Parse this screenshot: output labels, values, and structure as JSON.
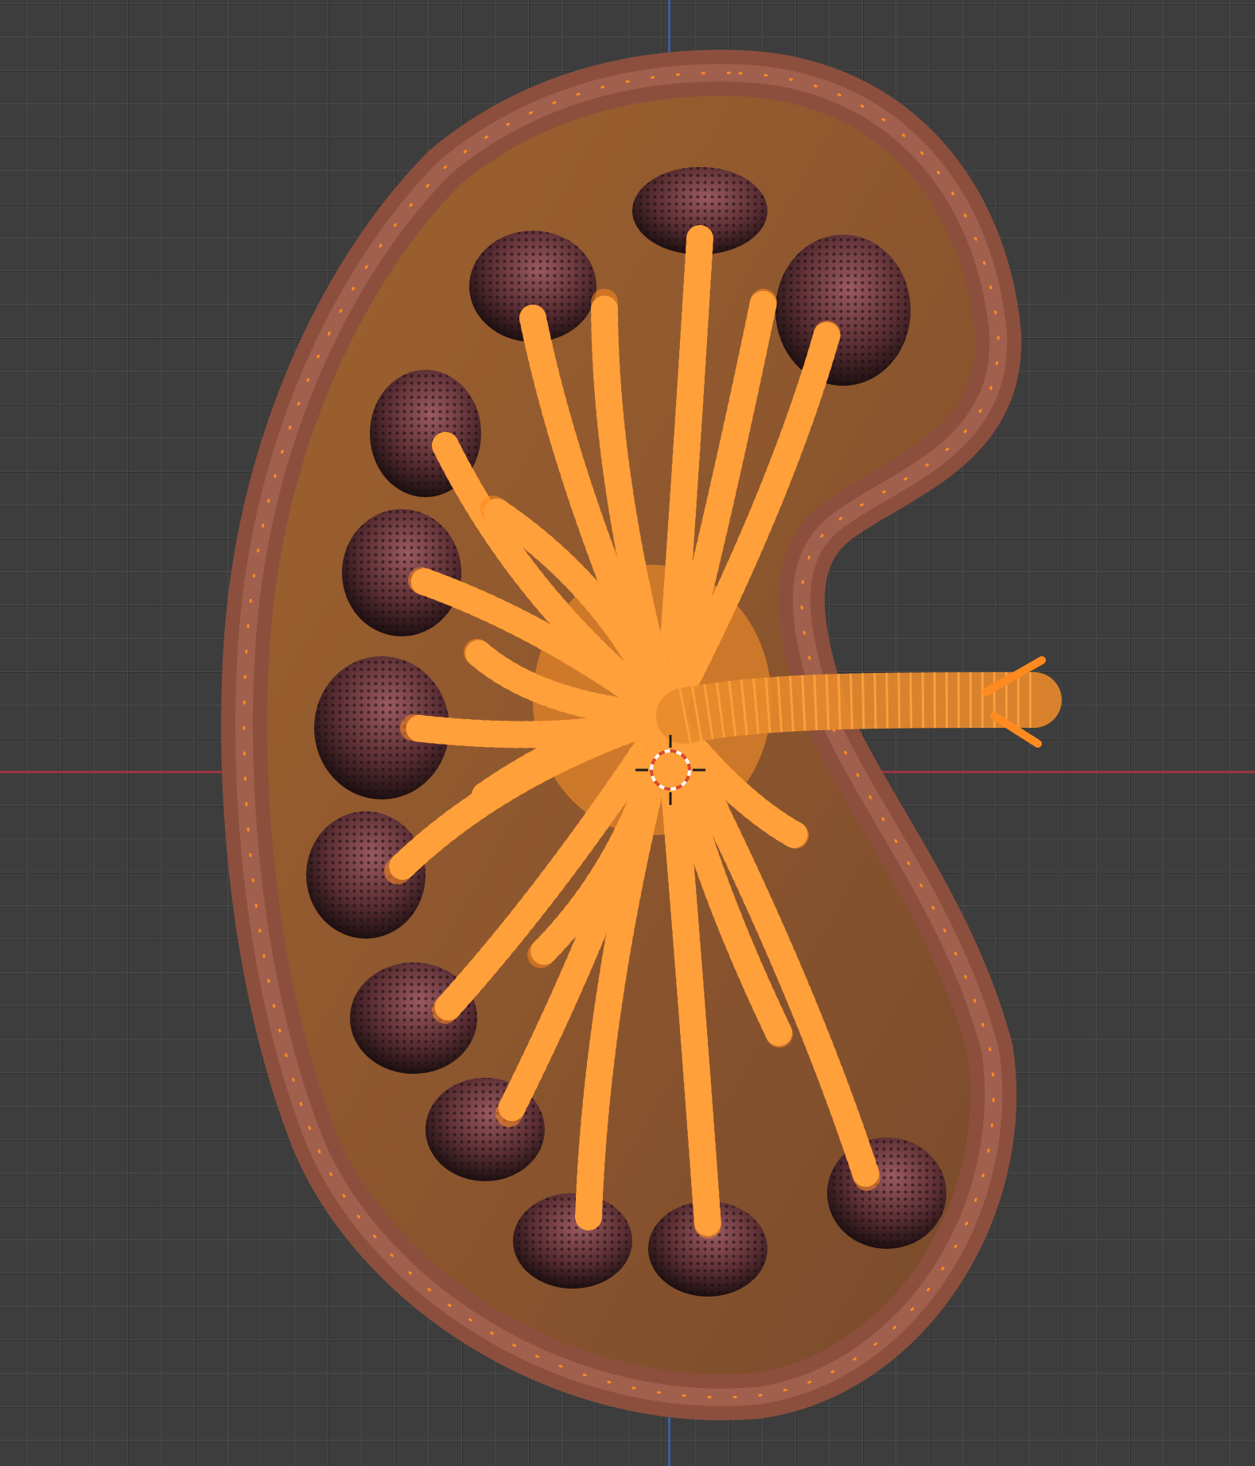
{
  "viewport": {
    "grid_visible": true,
    "x_axis_color": "#9a3441",
    "y_axis_color": "#3b5f9c",
    "background_color": "#3d3d3d"
  },
  "scene": {
    "object": "kidney-mesh",
    "mode": "edit",
    "selection_color": "#ff8a1f",
    "cortex_color": "#9c5a48",
    "pyramid_color": "#6e3a3f",
    "cursor_icon": "3d-cursor-icon"
  }
}
